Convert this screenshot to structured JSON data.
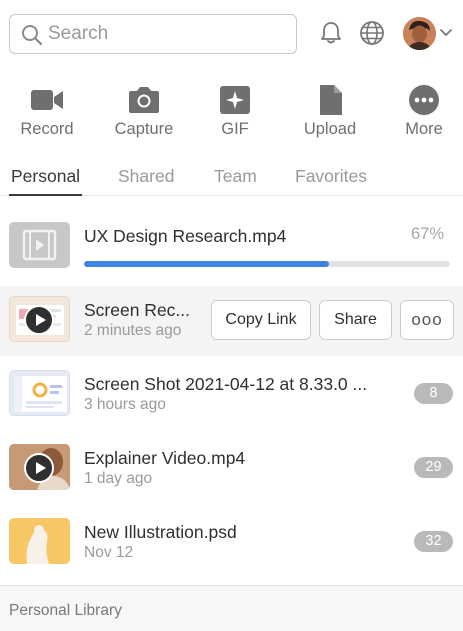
{
  "search": {
    "placeholder": "Search"
  },
  "header_icons": [
    "search-icon",
    "bell-icon",
    "globe-icon",
    "avatar",
    "chevron-down-icon"
  ],
  "actions": [
    {
      "label": "Record",
      "icon": "video-camera-icon"
    },
    {
      "label": "Capture",
      "icon": "camera-icon"
    },
    {
      "label": "GIF",
      "icon": "gif-sparkle-icon"
    },
    {
      "label": "Upload",
      "icon": "document-icon"
    },
    {
      "label": "More",
      "icon": "more-dots-icon"
    }
  ],
  "tabs": [
    {
      "label": "Personal",
      "active": true
    },
    {
      "label": "Shared",
      "active": false
    },
    {
      "label": "Team",
      "active": false
    },
    {
      "label": "Favorites",
      "active": false
    }
  ],
  "uploading": {
    "title": "UX Design Research.mp4",
    "percent_label": "67%",
    "progress": 0.67,
    "accent": "#3d86e0"
  },
  "items": [
    {
      "title": "Screen Rec...",
      "subtitle": "2 minutes ago",
      "thumb": "recording"
    },
    {
      "title": "Screen Shot 2021-04-12 at 8.33.0 ...",
      "subtitle": "3 hours ago",
      "badge": "8",
      "thumb": "dashboard"
    },
    {
      "title": "Explainer Video.mp4",
      "subtitle": "1 day ago",
      "badge": "29",
      "thumb": "video"
    },
    {
      "title": "New Illustration.psd",
      "subtitle": "Nov 12",
      "badge": "32",
      "thumb": "illustration"
    }
  ],
  "row_actions": {
    "copy_link": "Copy Link",
    "share": "Share",
    "more": "ooo"
  },
  "footer": {
    "label": "Personal Library"
  }
}
